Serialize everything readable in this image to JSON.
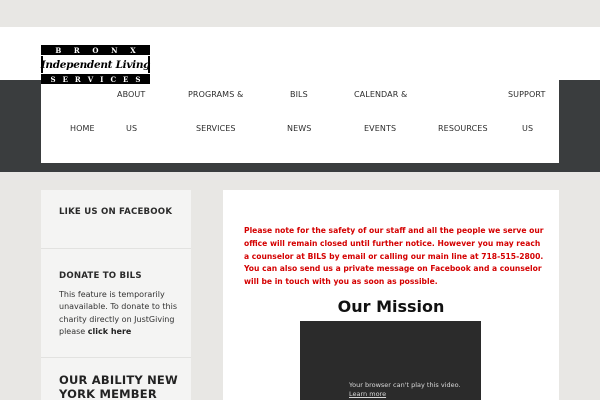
{
  "logo": {
    "line1": [
      "B",
      "R",
      "O",
      "N",
      "X"
    ],
    "line2": "Independent Living",
    "line3": [
      "S",
      "E",
      "R",
      "V",
      "I",
      "C",
      "E",
      "S"
    ]
  },
  "nav": {
    "items": [
      {
        "line1": "",
        "line2": "HOME"
      },
      {
        "line1": "ABOUT",
        "line2": "US"
      },
      {
        "line1": "PROGRAMS &",
        "line2": "SERVICES"
      },
      {
        "line1": "BILS",
        "line2": "NEWS"
      },
      {
        "line1": "CALENDAR &",
        "line2": "EVENTS"
      },
      {
        "line1": "",
        "line2": "RESOURCES"
      },
      {
        "line1": "SUPPORT",
        "line2": "US"
      }
    ]
  },
  "sidebar": {
    "facebook_title": "LIKE US ON FACEBOOK",
    "donate_title": "DONATE TO BILS",
    "donate_text": "This feature is temporarily unavailable. To donate to this charity directly on JustGiving please",
    "donate_link": "click here",
    "member_title": "OUR ABILITY NEW YORK MEMBER"
  },
  "main": {
    "notice": "Please note for the safety of our staff and all the people we serve our office will remain closed until further notice. However you may reach a counselor at BILS by email or calling our main line at 718-515-2800. You can also send us a private message on Facebook and a counselor will be in touch with you as soon as possible.",
    "mission_heading": "Our Mission",
    "video_message": "Your browser can't play this video.",
    "video_link": "Learn more"
  },
  "colors": {
    "page_bg": "#e8e7e4",
    "header_dark": "#3a3d3e",
    "notice_red": "#d40000",
    "video_bg": "#2b2b2b"
  }
}
